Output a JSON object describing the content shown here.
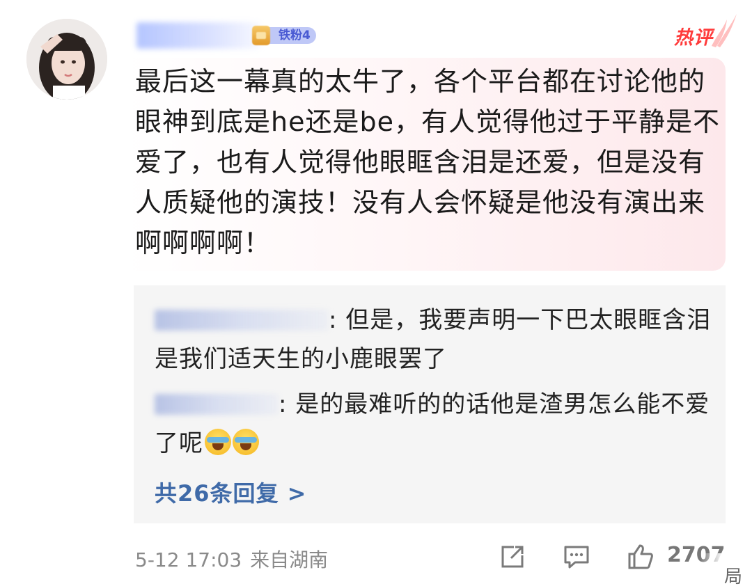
{
  "comment": {
    "hot_tag": "热评",
    "fan_badge": "铁粉4",
    "text": "最后这一幕真的太牛了，各个平台都在讨论他的眼神到底是he还是be，有人觉得他过于平静是不爱了，也有人觉得他眼眶含泪是还爱，但是没有人质疑他的演技！没有人会怀疑是他没有演出来啊啊啊啊！",
    "timestamp": "5-12 17:03",
    "location": "来自湖南",
    "like_count": "2707"
  },
  "replies": [
    {
      "text": ": 但是，我要声明一下巴太眼眶含泪是我们适天生的小鹿眼罢了"
    },
    {
      "text": ": 是的最难听的的话他是渣男怎么能不爱了呢"
    }
  ],
  "more_replies_label": "共26条回复 >",
  "watermark_text": "局",
  "icons": [
    "avatar",
    "hot-flame-icon",
    "share-icon",
    "comment-icon",
    "like-icon",
    "crying-laugh-emoji"
  ],
  "colors": {
    "hot": "#ff3b3b",
    "link": "#3f6aa8",
    "reply_bg": "#f5f5f5",
    "bubble_pink": "#fde8eb"
  }
}
